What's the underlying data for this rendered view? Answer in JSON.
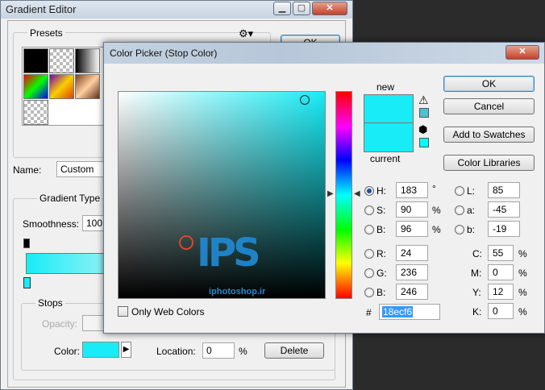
{
  "gradient_editor": {
    "title": "Gradient Editor",
    "presets_label": "Presets",
    "ok_label": "OK",
    "name_label": "Name:",
    "name_value": "Custom",
    "gradient_type_label": "Gradient Type",
    "smoothness_label": "Smoothness:",
    "smoothness_value": "100",
    "stops_label": "Stops",
    "opacity_label": "Opacity:",
    "color_label": "Color:",
    "location_label": "Location:",
    "location_value": "0",
    "location_unit": "%",
    "delete_label": "Delete",
    "stop_color": "#18ecf6"
  },
  "color_picker": {
    "title": "Color Picker (Stop Color)",
    "new_label": "new",
    "current_label": "current",
    "ok_label": "OK",
    "cancel_label": "Cancel",
    "add_swatches_label": "Add to Swatches",
    "color_libraries_label": "Color Libraries",
    "only_web_colors_label": "Only Web Colors",
    "hex_prefix": "#",
    "hex_value": "18ecf6",
    "new_color": "#18ecf6",
    "current_color": "#18ecf6",
    "gamut_warning_color": "#4fc0d6",
    "websafe_color": "#00ffff",
    "watermark_text": "iphotoshop.ir",
    "hsb": [
      {
        "label": "H:",
        "value": "183",
        "unit": "°"
      },
      {
        "label": "S:",
        "value": "90",
        "unit": "%"
      },
      {
        "label": "B:",
        "value": "96",
        "unit": "%"
      }
    ],
    "rgb": [
      {
        "label": "R:",
        "value": "24"
      },
      {
        "label": "G:",
        "value": "236"
      },
      {
        "label": "B:",
        "value": "246"
      }
    ],
    "lab": [
      {
        "label": "L:",
        "value": "85"
      },
      {
        "label": "a:",
        "value": "-45"
      },
      {
        "label": "b:",
        "value": "-19"
      }
    ],
    "cmyk": [
      {
        "label": "C:",
        "value": "55",
        "unit": "%"
      },
      {
        "label": "M:",
        "value": "0",
        "unit": "%"
      },
      {
        "label": "Y:",
        "value": "12",
        "unit": "%"
      },
      {
        "label": "K:",
        "value": "0",
        "unit": "%"
      }
    ]
  }
}
